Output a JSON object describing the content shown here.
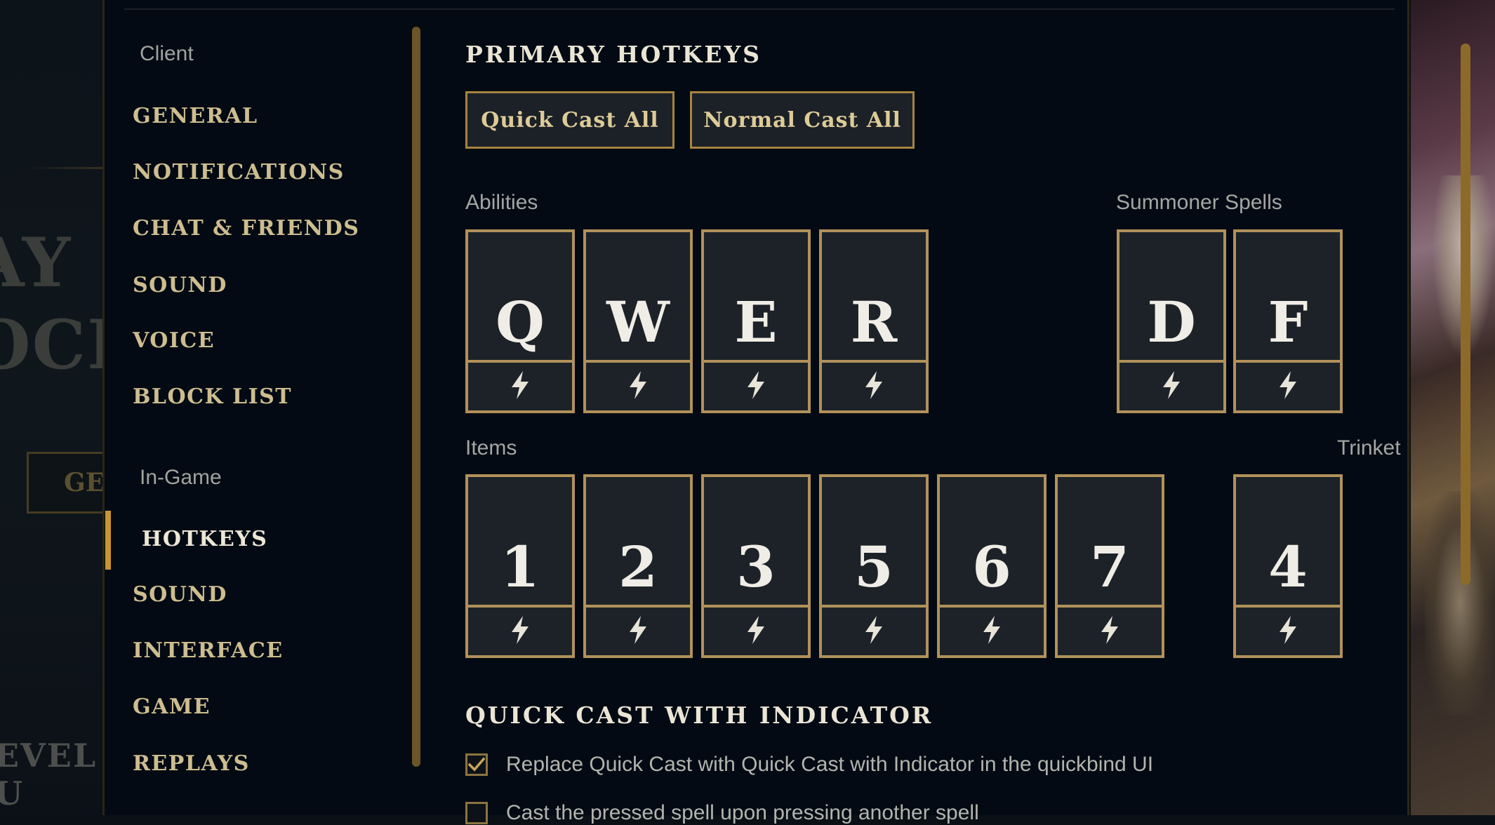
{
  "background": {
    "left_title_line1": "AY",
    "left_title_line2": "OCK",
    "left_button_partial": "GE",
    "left_footer_partial": "EVEL U"
  },
  "sidebar": {
    "client_label": "Client",
    "client_items": [
      {
        "label": "GENERAL"
      },
      {
        "label": "NOTIFICATIONS"
      },
      {
        "label": "CHAT & FRIENDS"
      },
      {
        "label": "SOUND"
      },
      {
        "label": "VOICE"
      },
      {
        "label": "BLOCK LIST"
      }
    ],
    "ingame_label": "In-Game",
    "ingame_items": [
      {
        "label": "HOTKEYS",
        "active": true
      },
      {
        "label": "SOUND"
      },
      {
        "label": "INTERFACE"
      },
      {
        "label": "GAME"
      },
      {
        "label": "REPLAYS"
      }
    ]
  },
  "primary_hotkeys": {
    "title": "PRIMARY HOTKEYS",
    "quick_cast_all": "Quick Cast All",
    "normal_cast_all": "Normal Cast All",
    "abilities_label": "Abilities",
    "abilities": [
      "Q",
      "W",
      "E",
      "R"
    ],
    "summoner_label": "Summoner Spells",
    "summoner_spells": [
      "D",
      "F"
    ],
    "items_label": "Items",
    "items": [
      "1",
      "2",
      "3",
      "5",
      "6",
      "7"
    ],
    "trinket_label": "Trinket",
    "trinket": [
      "4"
    ],
    "quickcast_icon": "lightning-bolt-icon"
  },
  "quick_cast_indicator": {
    "title": "QUICK CAST WITH INDICATOR",
    "options": [
      {
        "label": "Replace Quick Cast with Quick Cast with Indicator in the quickbind UI",
        "checked": true
      },
      {
        "label": "Cast the pressed spell upon pressing another spell",
        "checked": false
      }
    ]
  },
  "colors": {
    "accent_gold": "#c8952f",
    "border_gold": "#b1915a",
    "panel_bg": "#030a13",
    "key_bg": "#1c2228"
  }
}
